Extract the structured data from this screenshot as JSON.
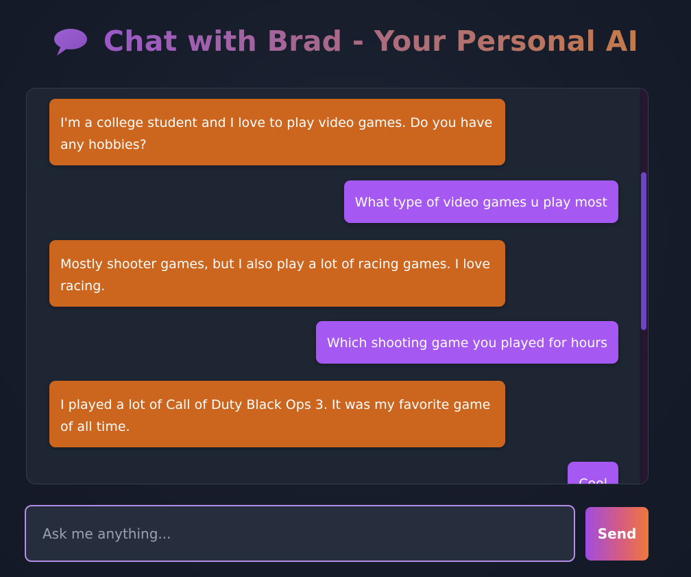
{
  "header": {
    "icon": "speech-bubble-icon",
    "title": "Chat with Brad - Your Personal AI"
  },
  "messages": [
    {
      "sender": "bot",
      "text": "I'm a college student and I love to play video games. Do you have any hobbies?"
    },
    {
      "sender": "user",
      "text": "What type of video games u play most"
    },
    {
      "sender": "bot",
      "text": "Mostly shooter games, but I also play a lot of racing games. I love racing."
    },
    {
      "sender": "user",
      "text": "Which shooting game you played for hours"
    },
    {
      "sender": "bot",
      "text": "I played a lot of Call of Duty Black Ops 3. It was my favorite game of all time."
    },
    {
      "sender": "user",
      "text": "Cool"
    }
  ],
  "input": {
    "placeholder": "Ask me anything...",
    "value": ""
  },
  "send_button": {
    "label": "Send"
  },
  "colors": {
    "bot_bubble": "#cc661f",
    "user_bubble": "#a658f3",
    "background": "#161c29",
    "input_border": "#b68de8"
  }
}
